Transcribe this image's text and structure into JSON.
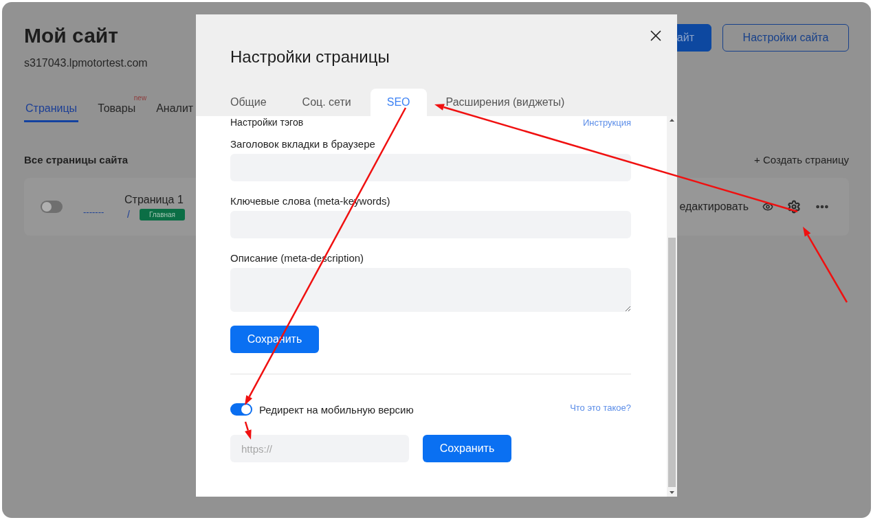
{
  "site": {
    "title": "Мой сайт",
    "domain": "s317043.lpmotortest.com",
    "buttons": [
      {
        "label": "айт",
        "kind": "primary"
      },
      {
        "label": "Настройки сайта",
        "kind": "outline"
      }
    ]
  },
  "nav_tabs": [
    {
      "label": "Страницы",
      "selected": true
    },
    {
      "label": "Товары",
      "selected": false,
      "badge": "new"
    },
    {
      "label": "Аналит",
      "selected": false
    }
  ],
  "pages_section": {
    "title": "Все страницы сайта",
    "create_link": "+ Создать страницу",
    "pages": [
      {
        "on": false,
        "link": "-------",
        "name": "Страница 1",
        "path": "/",
        "tag": "Главная",
        "edit_label": "едактировать"
      }
    ]
  },
  "dialog": {
    "title": "Настройки страницы",
    "tabs": [
      {
        "label": "Общие",
        "selected": false
      },
      {
        "label": "Соц. сети",
        "selected": false
      },
      {
        "label": "SEO",
        "selected": true
      },
      {
        "label": "Расширения (виджеты)",
        "selected": false
      }
    ],
    "section_title": "Настройки тэгов",
    "help_link": "Инструкция",
    "fields": [
      {
        "label": "Заголовок вкладки в браузере",
        "kind": "input"
      },
      {
        "label": "Ключевые слова (meta-keywords)",
        "kind": "input"
      },
      {
        "label": "Описание (meta-description)",
        "kind": "textarea"
      }
    ],
    "save_label": "Сохранить",
    "redirect": {
      "label": "Редирект на мобильную версию",
      "on": true,
      "help_link": "Что это такое?",
      "placeholder": "https://",
      "save_label": "Сохранить"
    }
  }
}
